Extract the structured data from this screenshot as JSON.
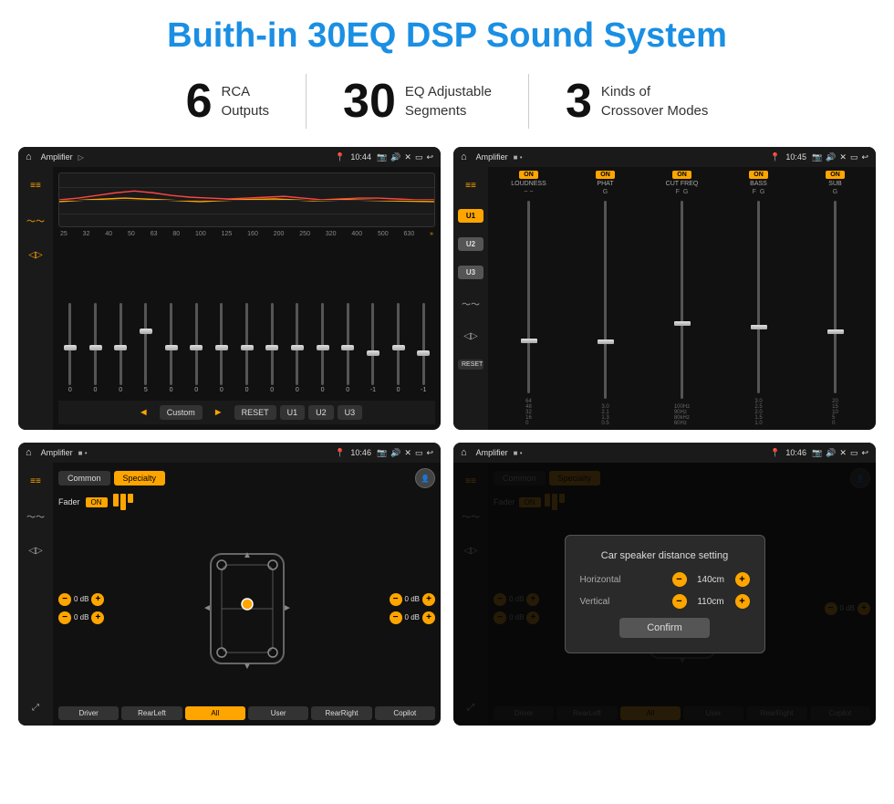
{
  "title": "Buith-in 30EQ DSP Sound System",
  "stats": [
    {
      "number": "6",
      "label": "RCA\nOutputs"
    },
    {
      "number": "30",
      "label": "EQ Adjustable\nSegments"
    },
    {
      "number": "3",
      "label": "Kinds of\nCrossover Modes"
    }
  ],
  "screens": [
    {
      "id": "screen1",
      "topbar": {
        "title": "Amplifier",
        "time": "10:44"
      },
      "eq_labels": [
        "25",
        "32",
        "40",
        "50",
        "63",
        "80",
        "100",
        "125",
        "160",
        "200",
        "250",
        "320",
        "400",
        "500",
        "630"
      ],
      "eq_values": [
        "0",
        "0",
        "0",
        "5",
        "0",
        "0",
        "0",
        "0",
        "0",
        "0",
        "0",
        "0",
        "-1",
        "0",
        "-1"
      ],
      "buttons": [
        "Custom",
        "RESET",
        "U1",
        "U2",
        "U3"
      ]
    },
    {
      "id": "screen2",
      "topbar": {
        "title": "Amplifier",
        "time": "10:45"
      },
      "channels": [
        {
          "label": "LOUDNESS",
          "on": true
        },
        {
          "label": "PHAT",
          "on": true
        },
        {
          "label": "CUT FREQ",
          "on": true
        },
        {
          "label": "BASS",
          "on": true
        },
        {
          "label": "SUB",
          "on": true
        }
      ],
      "u_buttons": [
        "U1",
        "U2",
        "U3"
      ],
      "reset": "RESET"
    },
    {
      "id": "screen3",
      "topbar": {
        "title": "Amplifier",
        "time": "10:46"
      },
      "tabs": [
        "Common",
        "Specialty"
      ],
      "fader_label": "Fader",
      "fader_on": "ON",
      "buttons": [
        "Driver",
        "RearLeft",
        "All",
        "User",
        "RearRight",
        "Copilot"
      ],
      "db_values": [
        "0 dB",
        "0 dB",
        "0 dB",
        "0 dB"
      ]
    },
    {
      "id": "screen4",
      "topbar": {
        "title": "Amplifier",
        "time": "10:46"
      },
      "tabs": [
        "Common",
        "Specialty"
      ],
      "dialog": {
        "title": "Car speaker distance setting",
        "fields": [
          {
            "label": "Horizontal",
            "value": "140cm"
          },
          {
            "label": "Vertical",
            "value": "110cm"
          }
        ],
        "confirm_label": "Confirm"
      },
      "buttons": [
        "Driver",
        "RearLeft",
        "All",
        "User",
        "RearRight",
        "Copilot"
      ],
      "db_values": [
        "0 dB",
        "0 dB"
      ]
    }
  ]
}
